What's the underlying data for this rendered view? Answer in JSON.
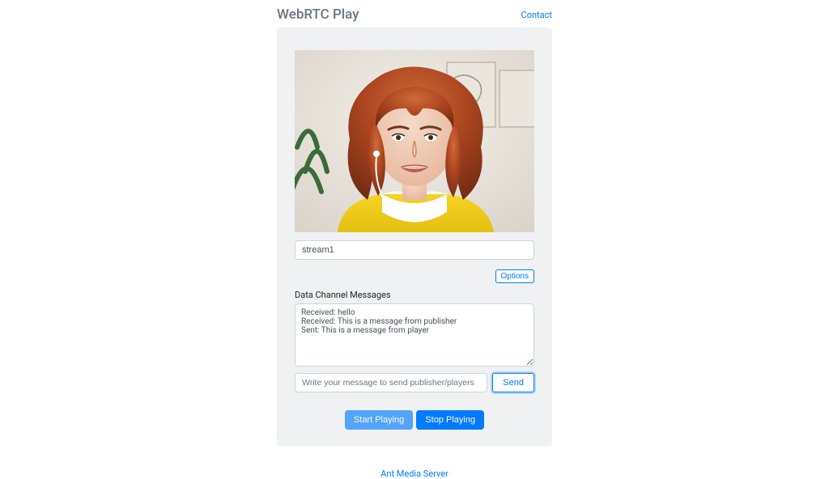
{
  "header": {
    "title": "WebRTC Play",
    "contact_label": "Contact"
  },
  "stream": {
    "id_value": "stream1"
  },
  "buttons": {
    "options": "Options",
    "send": "Send",
    "start": "Start Playing",
    "stop": "Stop Playing"
  },
  "data_channel": {
    "section_label": "Data Channel Messages",
    "messages_text": "Received: hello\nReceived: This is a message from publisher\nSent: This is a message from player",
    "input_placeholder": "Write your message to send publisher/players"
  },
  "footer": {
    "link_text": "Ant Media Server"
  }
}
